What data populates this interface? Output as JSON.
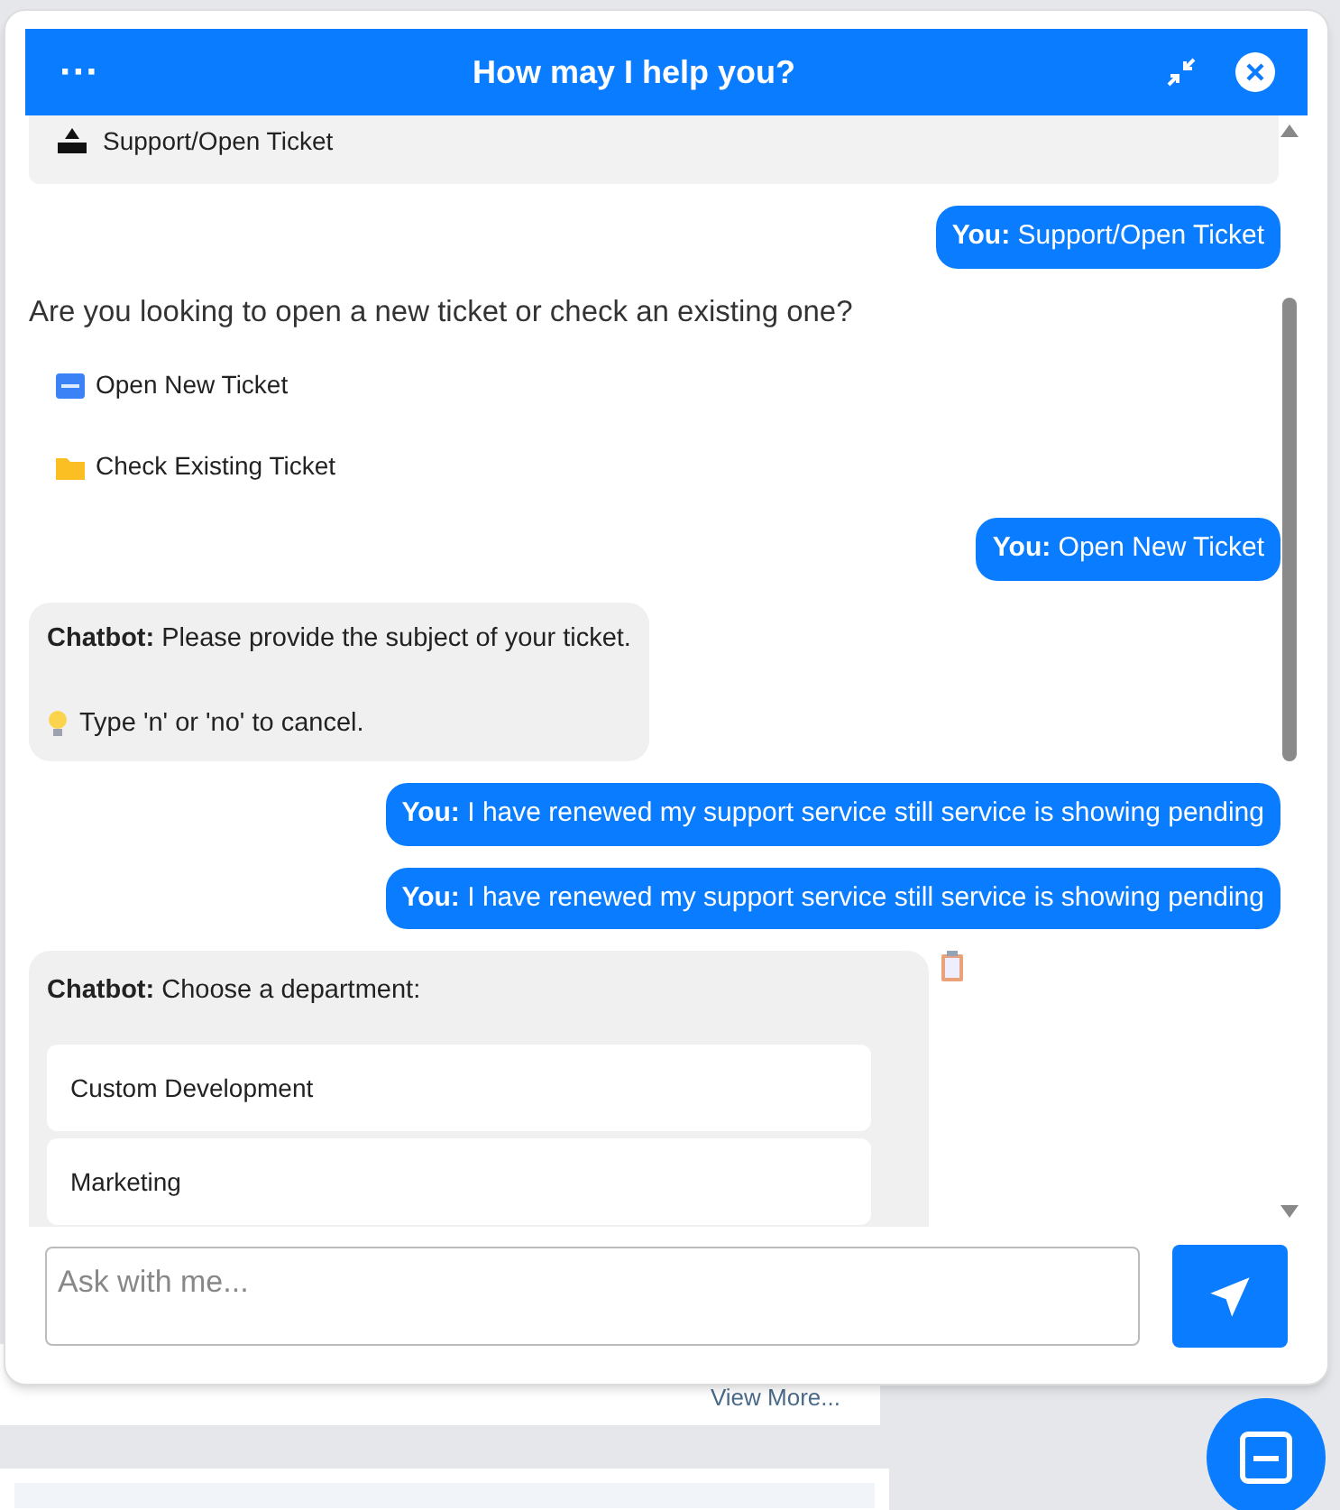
{
  "header": {
    "menu": "···",
    "title": "How may I help you?"
  },
  "messages": [
    {
      "kind": "option",
      "text": "Support/Open Ticket"
    },
    {
      "kind": "user",
      "sender": "You:",
      "text": "Support/Open Ticket"
    },
    {
      "kind": "plain",
      "text": "Are you looking to open a new ticket or check an existing one?"
    },
    {
      "kind": "link",
      "text": "Open New Ticket"
    },
    {
      "kind": "link",
      "text": "Check Existing Ticket"
    },
    {
      "kind": "user",
      "sender": "You:",
      "text": "Open New Ticket"
    },
    {
      "kind": "bot",
      "sender": "Chatbot:",
      "text": "Please provide the subject of your ticket.",
      "hint": "Type 'n' or 'no' to cancel."
    },
    {
      "kind": "user",
      "sender": "You:",
      "text": "I have renewed my support service still service is showing pending"
    },
    {
      "kind": "user",
      "sender": "You:",
      "text": "I have renewed my support service still service is showing pending"
    },
    {
      "kind": "choices",
      "sender": "Chatbot:",
      "text": "Choose a department:",
      "options": [
        "Custom Development",
        "Marketing"
      ]
    }
  ],
  "input": {
    "placeholder": "Ask with me..."
  },
  "background": {
    "link": "View More..."
  }
}
